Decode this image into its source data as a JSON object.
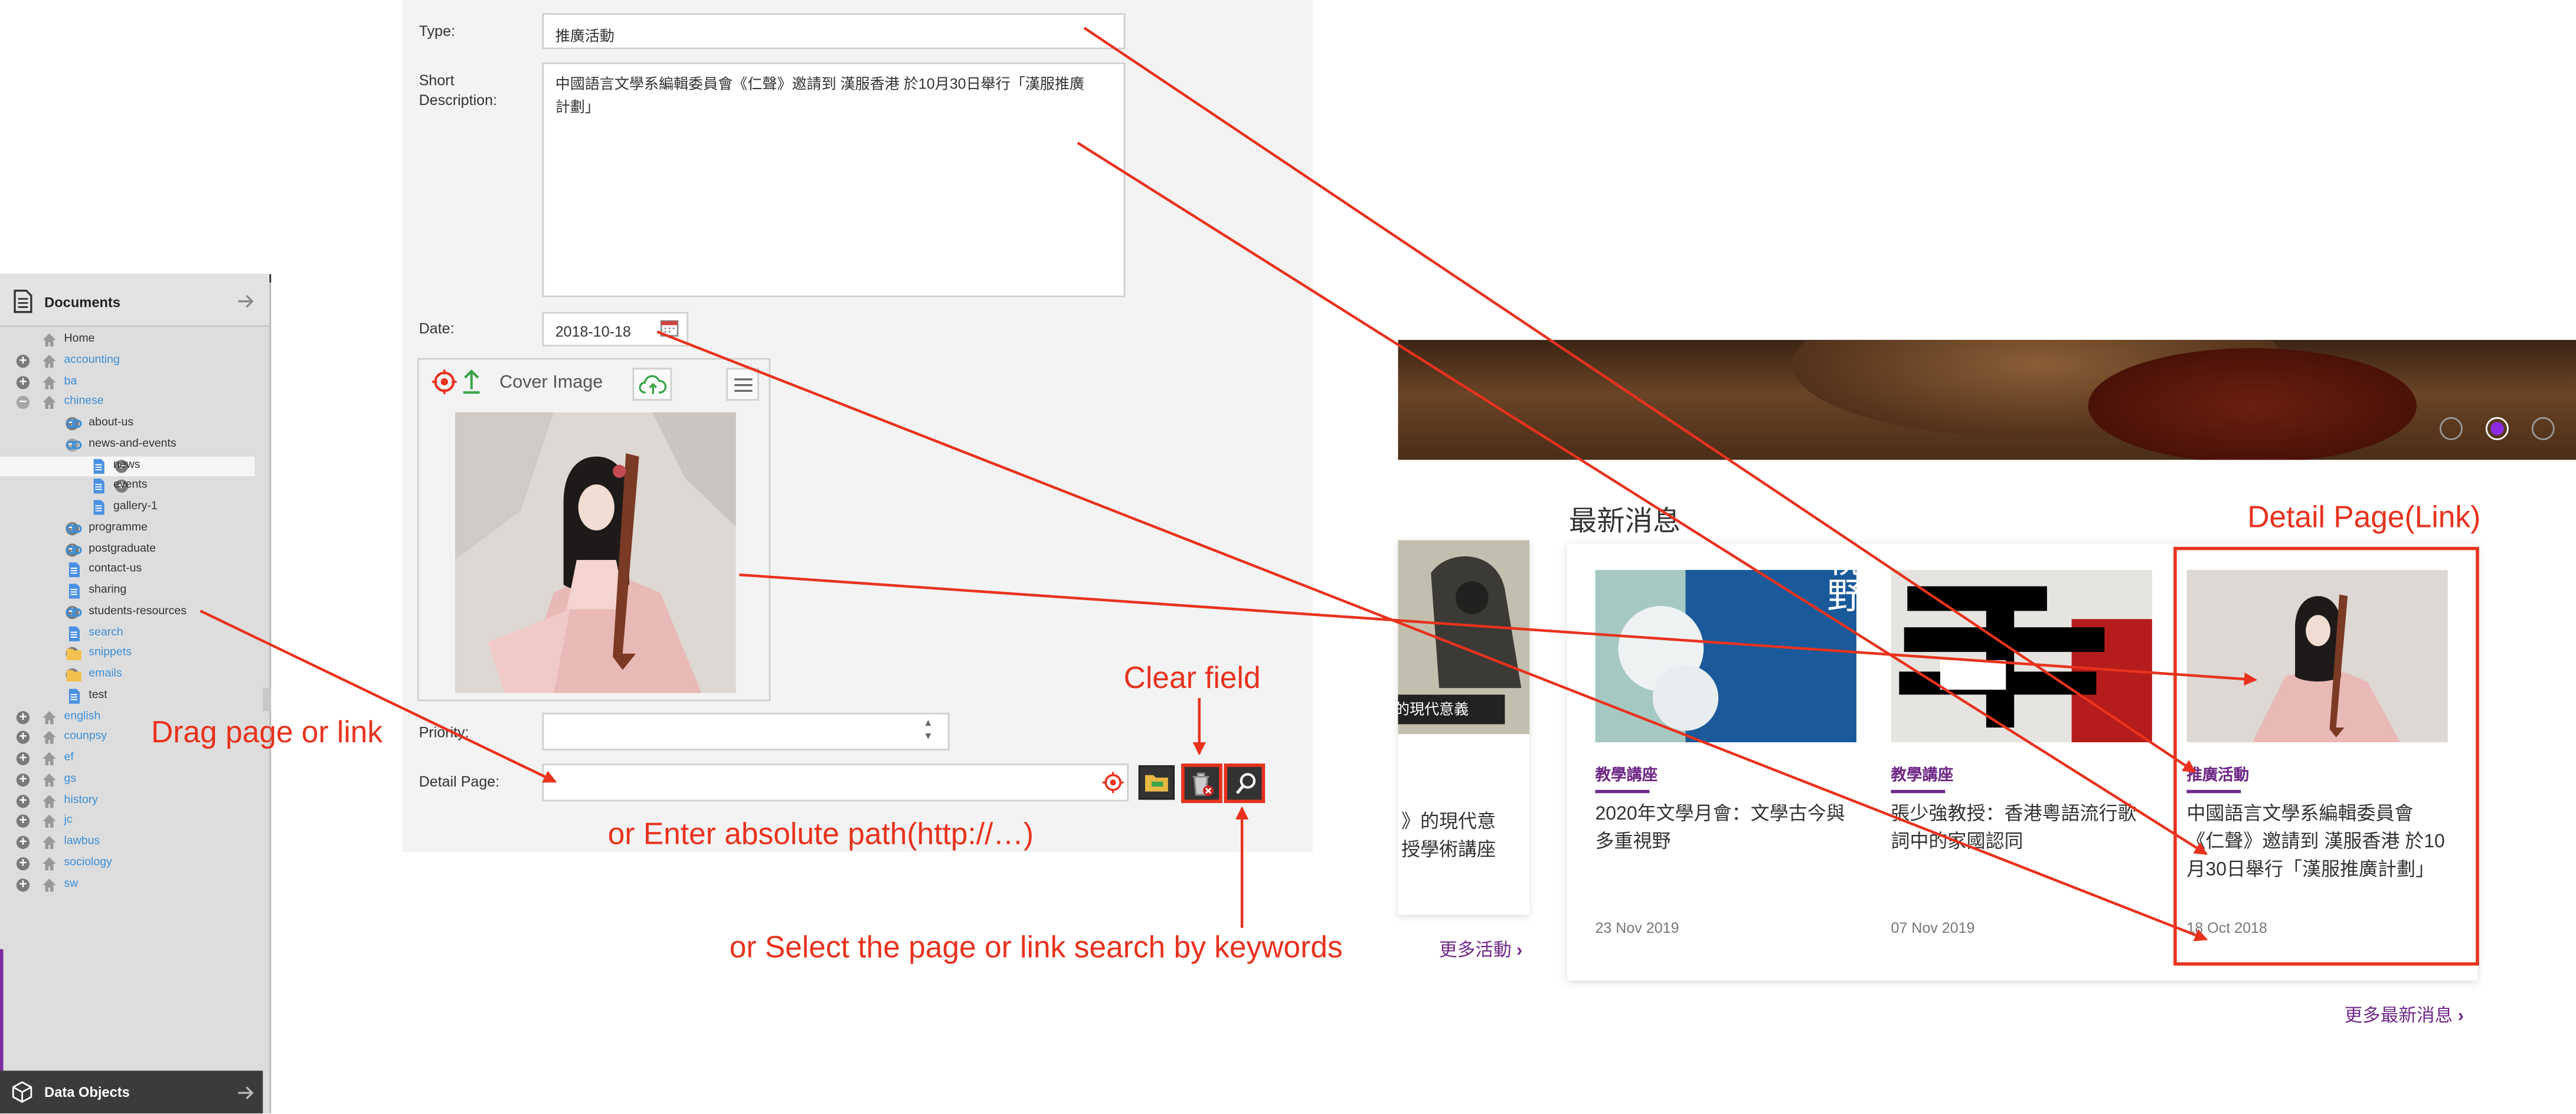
{
  "tree": {
    "title": "Documents",
    "footer": "Data Objects",
    "items": [
      {
        "label": "Home",
        "depth": 0,
        "icon": "home",
        "expand": "none",
        "color": "#333333"
      },
      {
        "label": "accounting",
        "depth": 0,
        "icon": "home",
        "expand": "plus",
        "color": "#3b8fd8"
      },
      {
        "label": "ba",
        "depth": 0,
        "icon": "home",
        "expand": "plus",
        "color": "#3b8fd8"
      },
      {
        "label": "chinese",
        "depth": 0,
        "icon": "home",
        "expand": "minus",
        "color": "#3b8fd8"
      },
      {
        "label": "about-us",
        "depth": 1,
        "icon": "link",
        "expand": "plus",
        "color": "#333333"
      },
      {
        "label": "news-and-events",
        "depth": 1,
        "icon": "link",
        "expand": "minus",
        "color": "#333333"
      },
      {
        "label": "news",
        "depth": 2,
        "icon": "doc",
        "expand": "plus",
        "color": "#333333",
        "selected": true
      },
      {
        "label": "events",
        "depth": 2,
        "icon": "doc",
        "expand": "plus",
        "color": "#333333"
      },
      {
        "label": "gallery-1",
        "depth": 2,
        "icon": "doc",
        "expand": "none",
        "color": "#333333"
      },
      {
        "label": "programme",
        "depth": 1,
        "icon": "link",
        "expand": "plus",
        "color": "#333333"
      },
      {
        "label": "postgraduate",
        "depth": 1,
        "icon": "link",
        "expand": "plus",
        "color": "#333333"
      },
      {
        "label": "contact-us",
        "depth": 1,
        "icon": "doc",
        "expand": "none",
        "color": "#333333"
      },
      {
        "label": "sharing",
        "depth": 1,
        "icon": "doc",
        "expand": "none",
        "color": "#333333"
      },
      {
        "label": "students-resources",
        "depth": 1,
        "icon": "link",
        "expand": "plus",
        "color": "#333333"
      },
      {
        "label": "search",
        "depth": 1,
        "icon": "doc",
        "expand": "none",
        "color": "#3b8fd8"
      },
      {
        "label": "snippets",
        "depth": 1,
        "icon": "folder",
        "expand": "plus",
        "color": "#3b8fd8"
      },
      {
        "label": "emails",
        "depth": 1,
        "icon": "folder",
        "expand": "plus",
        "color": "#3b8fd8"
      },
      {
        "label": "test",
        "depth": 1,
        "icon": "doc",
        "expand": "none",
        "color": "#333333"
      },
      {
        "label": "english",
        "depth": 0,
        "icon": "home",
        "expand": "plus",
        "color": "#3b8fd8"
      },
      {
        "label": "counpsy",
        "depth": 0,
        "icon": "home",
        "expand": "plus",
        "color": "#3b8fd8"
      },
      {
        "label": "ef",
        "depth": 0,
        "icon": "home",
        "expand": "plus",
        "color": "#3b8fd8"
      },
      {
        "label": "gs",
        "depth": 0,
        "icon": "home",
        "expand": "plus",
        "color": "#3b8fd8"
      },
      {
        "label": "history",
        "depth": 0,
        "icon": "home",
        "expand": "plus",
        "color": "#3b8fd8"
      },
      {
        "label": "jc",
        "depth": 0,
        "icon": "home",
        "expand": "plus",
        "color": "#3b8fd8"
      },
      {
        "label": "lawbus",
        "depth": 0,
        "icon": "home",
        "expand": "plus",
        "color": "#3b8fd8"
      },
      {
        "label": "sociology",
        "depth": 0,
        "icon": "home",
        "expand": "plus",
        "color": "#3b8fd8"
      },
      {
        "label": "sw",
        "depth": 0,
        "icon": "home",
        "expand": "plus",
        "color": "#3b8fd8"
      }
    ]
  },
  "form": {
    "type_label": "Type:",
    "type_value": "推廣活動",
    "short_label_1": "Short",
    "short_label_2": "Description:",
    "short_value_1": "中國語言文學系編輯委員會《仁聲》邀請到 漢服香港 於10月30日舉行「漢服推廣",
    "short_value_2": "計劃」",
    "date_label": "Date:",
    "date_value": "2018-10-18",
    "cover_label": "Cover Image",
    "priority_label": "Priority:",
    "detail_label": "Detail Page:",
    "detail_value": ""
  },
  "site": {
    "section_title": "最新消息",
    "more_events": "更多活動",
    "more_news": "更多最新消息",
    "partial_title_1": "》的現代意",
    "partial_title_2": "授學術講座",
    "partial_caption": "的現代意義",
    "slider_count": 3,
    "slider_active": 2,
    "cards": [
      {
        "category": "教學講座",
        "title": "2020年文學月會：文學古今與多重視野",
        "date": "23 Nov 2019",
        "art_text": "文學古今與多重視野"
      },
      {
        "category": "教學講座",
        "title": "張少強教授：香港粵語流行歌詞中的家國認同",
        "date": "07 Nov 2019"
      },
      {
        "category": "推廣活動",
        "title": "中國語言文學系編輯委員會《仁聲》邀請到 漢服香港 於10月30日舉行「漢服推廣計劃」",
        "date": "18 Oct 2018"
      }
    ]
  },
  "annotations": {
    "drag": "Drag page or link",
    "clear": "Clear field",
    "absolute": "or Enter absolute path(http://…)",
    "select": "or Select the page or link search by keywords",
    "detail": "Detail Page(Link)"
  },
  "colors": {
    "accent": "#6f2a87",
    "annotation": "#e8321e",
    "link": "#3b8fd8"
  }
}
